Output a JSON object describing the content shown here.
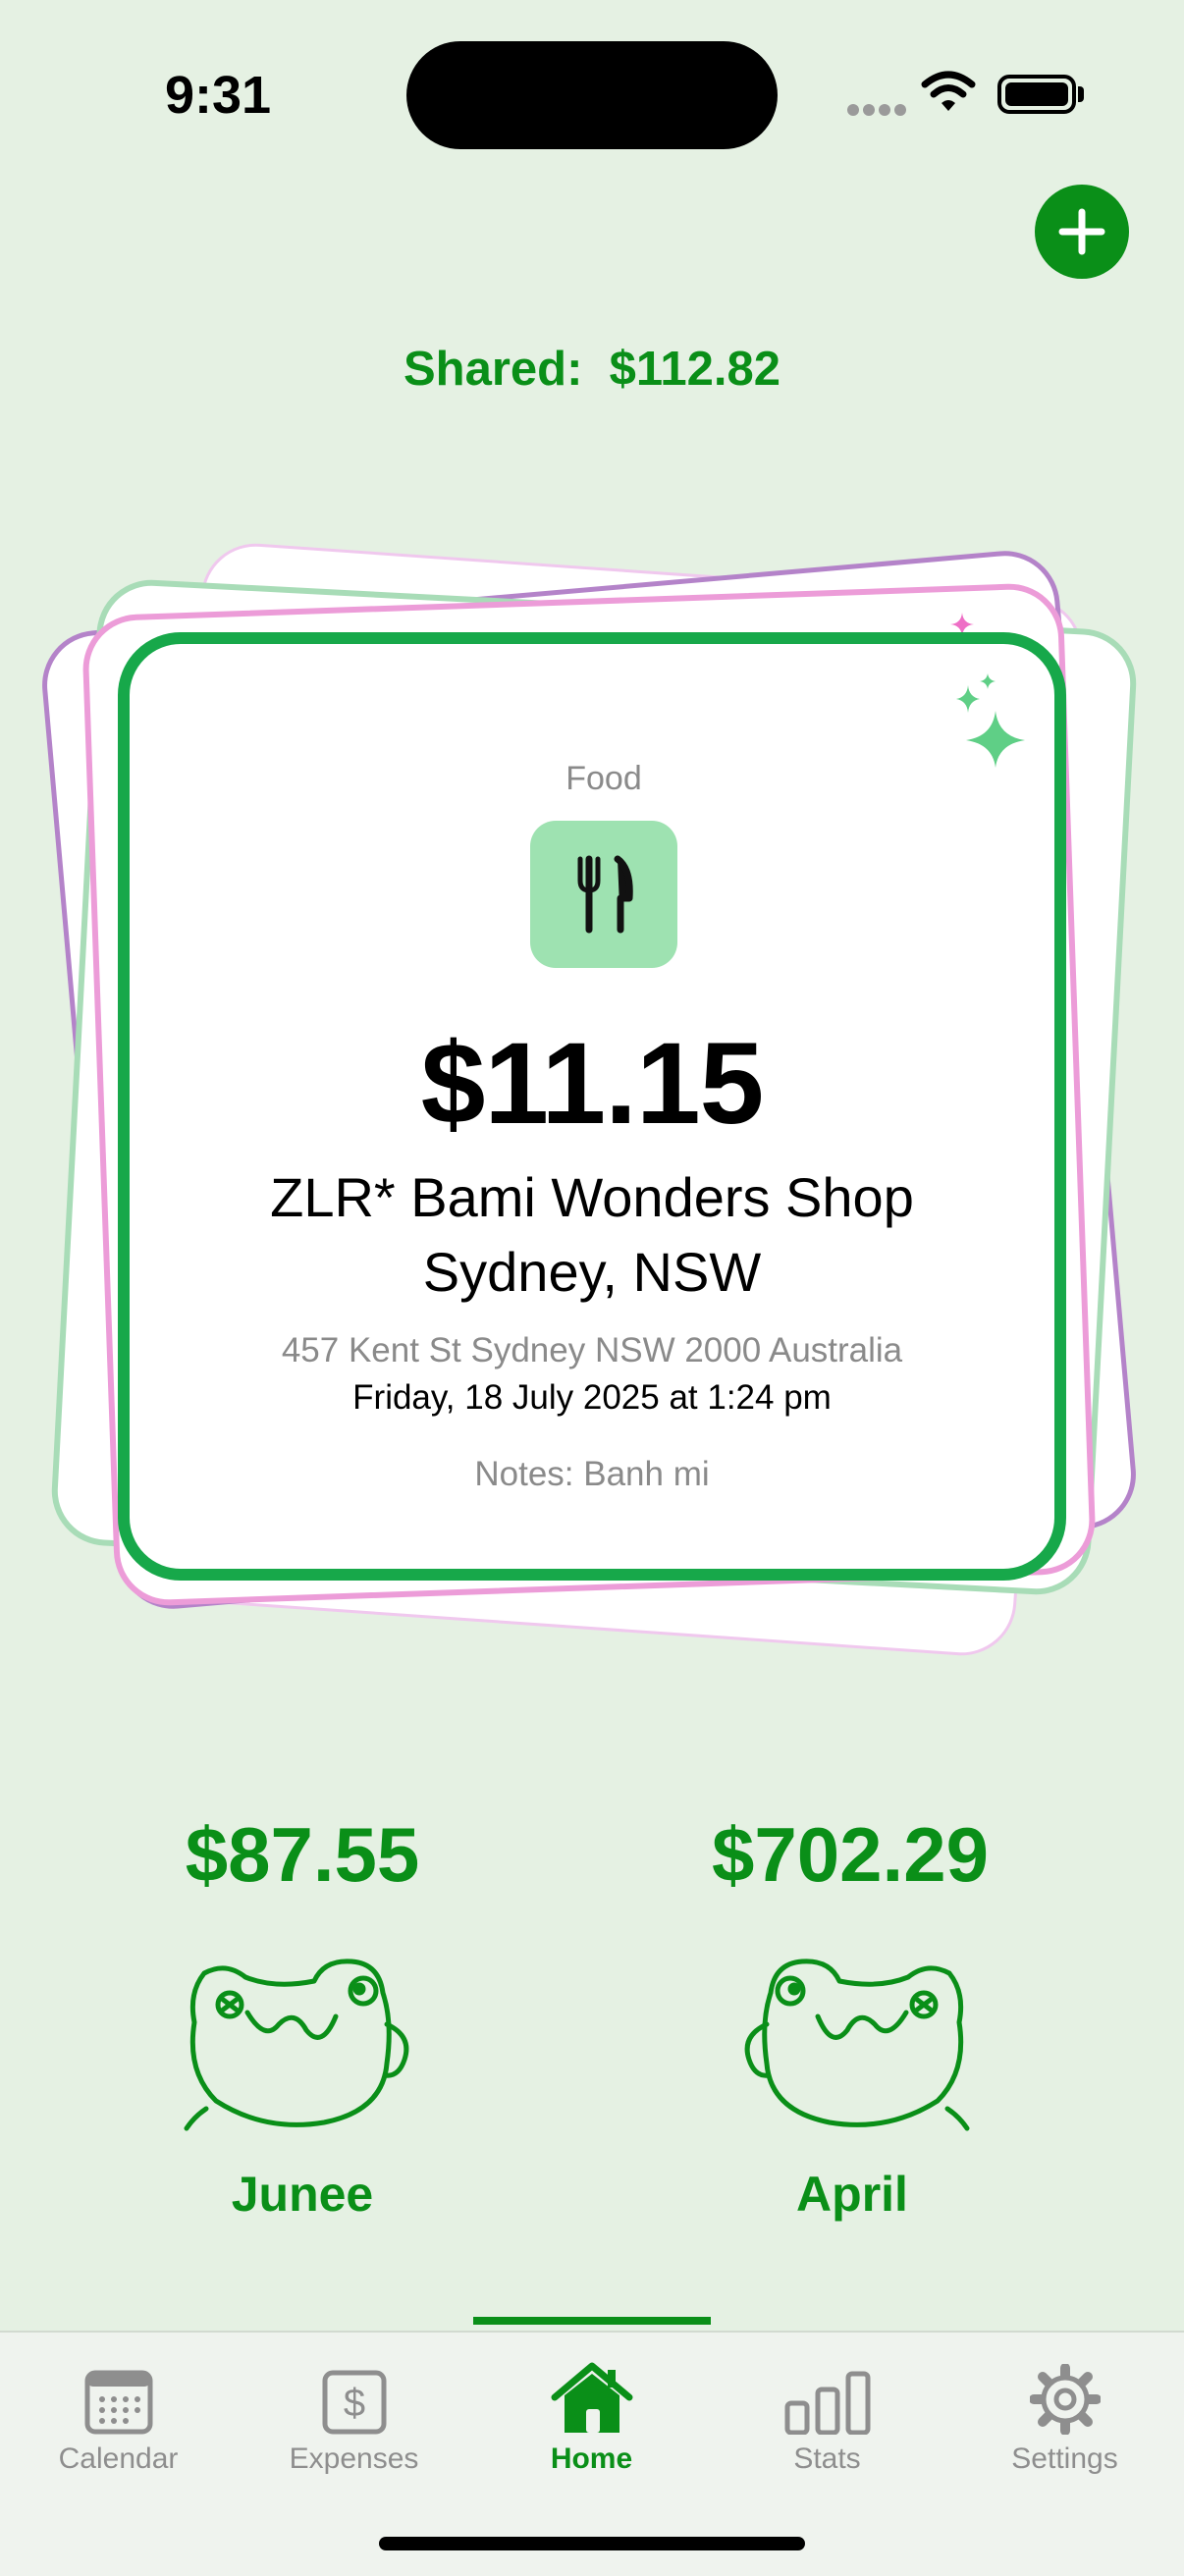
{
  "status_bar": {
    "time": "9:31"
  },
  "header": {
    "shared_label": "Shared:",
    "shared_amount": "$112.82"
  },
  "card": {
    "category": "Food",
    "category_icon": "fork-knife-icon",
    "amount": "$11.15",
    "merchant_line1": "ZLR* Bami Wonders Shop",
    "merchant_line2": "Sydney, NSW",
    "address": "457 Kent St Sydney NSW 2000 Australia",
    "datetime": "Friday, 18 July 2025 at 1:24 pm",
    "notes": "Notes: Banh mi"
  },
  "people": [
    {
      "name": "Junee",
      "amount": "$87.55"
    },
    {
      "name": "April",
      "amount": "$702.29"
    }
  ],
  "tabs": [
    {
      "label": "Calendar",
      "icon": "calendar-icon"
    },
    {
      "label": "Expenses",
      "icon": "dollar-icon"
    },
    {
      "label": "Home",
      "icon": "home-icon",
      "active": true
    },
    {
      "label": "Stats",
      "icon": "stats-icon"
    },
    {
      "label": "Settings",
      "icon": "gear-icon"
    }
  ],
  "colors": {
    "accent": "#0a8f18",
    "background": "#e5f1e3",
    "card_border": "#17a84a"
  }
}
